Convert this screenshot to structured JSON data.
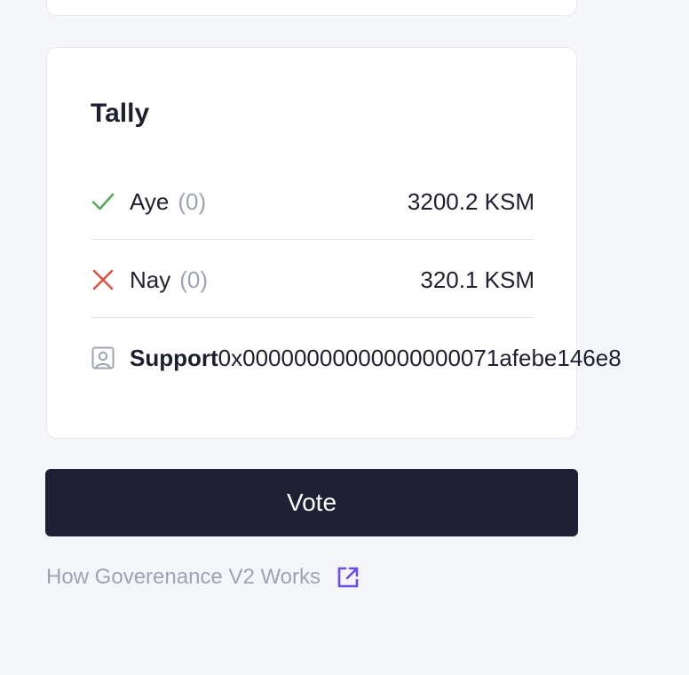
{
  "tally": {
    "title": "Tally",
    "aye": {
      "label": "Aye",
      "count": "(0)",
      "value": "3200.2 KSM",
      "icon": "check-icon",
      "color": "#5aa85a"
    },
    "nay": {
      "label": "Nay",
      "count": "(0)",
      "value": "320.1 KSM",
      "icon": "close-icon",
      "color": "#e0533f"
    },
    "support": {
      "label": "Support",
      "value": "0x00000000000000000071afebe146e8",
      "icon": "user-portrait-icon"
    }
  },
  "vote_button": {
    "label": "Vote"
  },
  "howto_link": {
    "label": "How Goverenance V2 Works",
    "icon": "external-link-icon",
    "icon_color": "#6a4cf0"
  },
  "colors": {
    "background": "#f5f6fa",
    "card": "#ffffff",
    "button": "#1f2033",
    "muted": "#9ea3b3"
  }
}
